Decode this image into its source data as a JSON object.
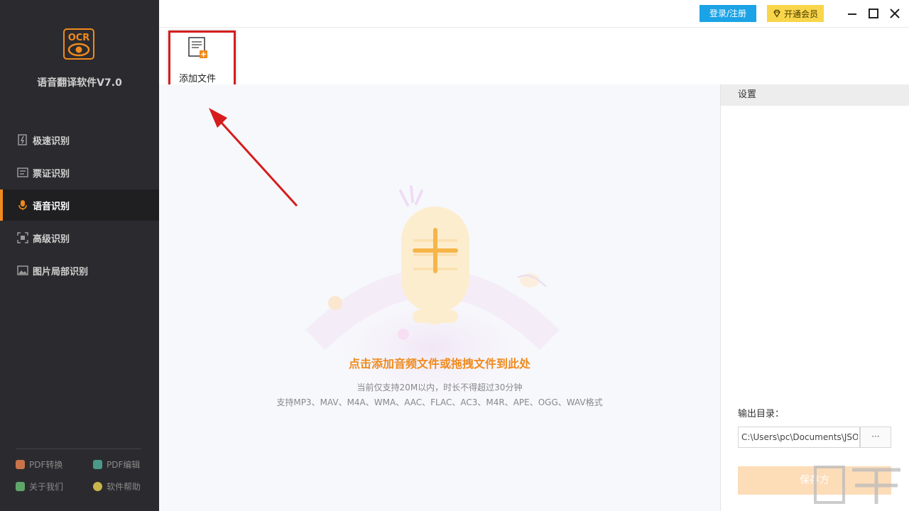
{
  "app": {
    "logo_text": "OCR",
    "title": "语音翻译软件V7.0"
  },
  "sidebar": {
    "items": [
      {
        "label": "极速识别",
        "icon": "lightning-doc-icon",
        "active": false
      },
      {
        "label": "票证识别",
        "icon": "ticket-icon",
        "active": false
      },
      {
        "label": "语音识别",
        "icon": "microphone-icon",
        "active": true
      },
      {
        "label": "高级识别",
        "icon": "scan-icon",
        "active": false
      },
      {
        "label": "图片局部识别",
        "icon": "image-icon",
        "active": false
      }
    ],
    "footer": [
      {
        "label": "PDF转换",
        "icon": "pdf-convert-icon",
        "color": "#c9734a"
      },
      {
        "label": "PDF编辑",
        "icon": "pdf-edit-icon",
        "color": "#4a9a8a"
      },
      {
        "label": "关于我们",
        "icon": "about-icon",
        "color": "#5fa56a"
      },
      {
        "label": "软件帮助",
        "icon": "help-icon",
        "color": "#c8b64a"
      }
    ]
  },
  "topbar": {
    "login_label": "登录/注册",
    "vip_label": "开通会员"
  },
  "toolbar": {
    "add_file_label": "添加文件"
  },
  "dropzone": {
    "title": "点击添加音频文件或拖拽文件到此处",
    "hint1": "当前仅支持20M以内，时长不得超过30分钟",
    "hint2": "支持MP3、MAV、M4A、WMA、AAC、FLAC、AC3、M4R、APE、OGG、WAV格式"
  },
  "settings": {
    "header": "设置",
    "output_label": "输出目录：",
    "output_path": "C:\\Users\\pc\\Documents\\JSO",
    "browse_label": "···",
    "save_label": "保存方"
  },
  "colors": {
    "accent": "#f08a1c",
    "sidebar_bg": "#2b2b2f",
    "login_blue": "#1aa3e6",
    "vip_yellow": "#f9d54a",
    "highlight_red": "#d51d1d"
  }
}
